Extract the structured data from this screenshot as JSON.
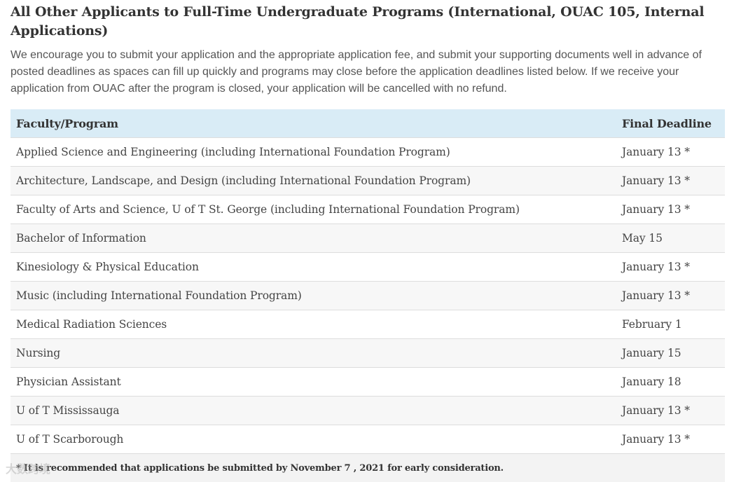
{
  "section": {
    "title": "All Other Applicants to Full-Time Undergraduate Programs (International, OUAC 105, Internal Applications)",
    "intro": "We encourage you to submit your application and the appropriate application fee, and submit your supporting documents well in advance of posted deadlines as spaces can fill up quickly and programs may close before the application deadlines listed below. If we receive your application from OUAC after the program is closed, your application will be cancelled with no refund."
  },
  "table": {
    "headers": {
      "program": "Faculty/Program",
      "deadline": "Final Deadline"
    },
    "rows": [
      {
        "program": "Applied Science and Engineering (including International Foundation Program)",
        "deadline": "January 13 *"
      },
      {
        "program": "Architecture, Landscape, and Design (including International Foundation Program)",
        "deadline": "January 13 *"
      },
      {
        "program": "Faculty of Arts and Science, U of T St. George (including International Foundation Program)",
        "deadline": "January 13 *"
      },
      {
        "program": "Bachelor of Information",
        "deadline": "May 15"
      },
      {
        "program": "Kinesiology & Physical Education",
        "deadline": "January 13 *"
      },
      {
        "program": "Music (including International Foundation Program)",
        "deadline": "January 13 *"
      },
      {
        "program": "Medical Radiation Sciences",
        "deadline": "February 1"
      },
      {
        "program": "Nursing",
        "deadline": "January 15"
      },
      {
        "program": "Physician Assistant",
        "deadline": "January 18"
      },
      {
        "program": "U of T Mississauga",
        "deadline": "January 13 *"
      },
      {
        "program": "U of T Scarborough",
        "deadline": "January 13 *"
      }
    ],
    "footnote": "* It is recommended that applications be submitted by November 7 , 2021 for early consideration."
  },
  "watermark": {
    "text": "大数跨境"
  }
}
